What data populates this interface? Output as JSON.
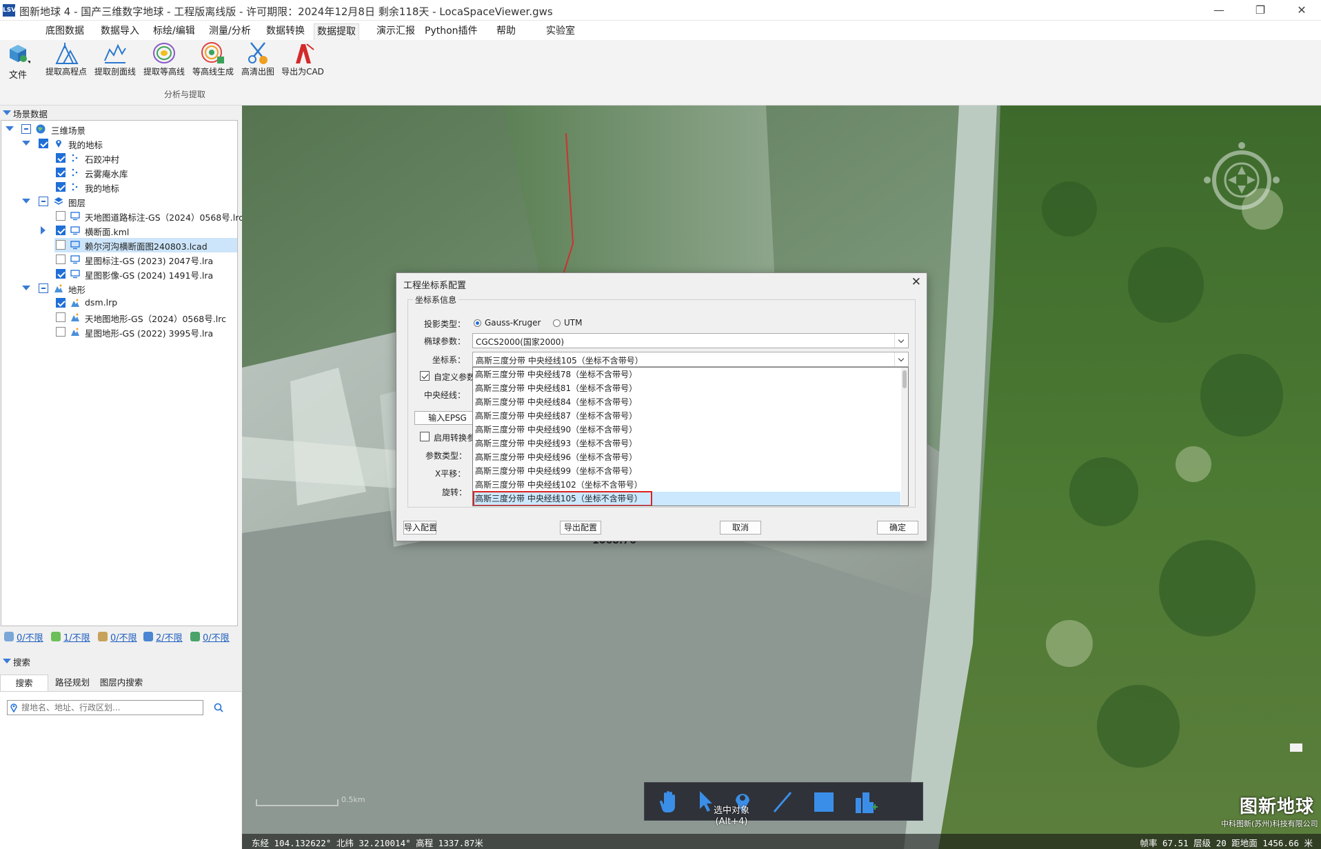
{
  "window": {
    "logo": "LSV",
    "title": "图新地球 4 - 国产三维数字地球 - 工程版离线版 - 许可期限：2024年12月8日 剩余118天 - LocaSpaceViewer.gws"
  },
  "menu": [
    "底图数据",
    "数据导入",
    "标绘/编辑",
    "测量/分析",
    "数据转换",
    "数据提取",
    "演示汇报",
    "Python插件",
    "帮助",
    "实验室"
  ],
  "ribbon": {
    "file_label": "文件",
    "tools": [
      "提取高程点",
      "提取剖面线",
      "提取等高线",
      "等高线生成",
      "高清出图",
      "导出为CAD"
    ],
    "group_label": "分析与提取"
  },
  "scene_panel": {
    "header": "场景数据",
    "tree": [
      {
        "label": "三维场景",
        "icon": "globe-icon"
      },
      {
        "label": "我的地标",
        "icon": "pin-icon"
      },
      {
        "label": "石跤冲村",
        "icon": "dots-icon"
      },
      {
        "label": "云雾庵水库",
        "icon": "dots-icon"
      },
      {
        "label": "我的地标",
        "icon": "dots-icon"
      },
      {
        "label": "图层",
        "icon": "layers-icon"
      },
      {
        "label": "天地图道路标注-GS（2024）0568号.lrc",
        "icon": "monitor-icon"
      },
      {
        "label": "横断面.kml",
        "icon": "monitor-icon"
      },
      {
        "label": "赖尔河沟横断面图240803.lcad",
        "icon": "monitor-icon"
      },
      {
        "label": "星图标注-GS (2023) 2047号.lra",
        "icon": "monitor-icon"
      },
      {
        "label": "星图影像-GS (2024) 1491号.lra",
        "icon": "monitor-icon"
      },
      {
        "label": "地形",
        "icon": "terrain-icon"
      },
      {
        "label": "dsm.lrp",
        "icon": "terrain-icon"
      },
      {
        "label": "天地图地形-GS（2024）0568号.lrc",
        "icon": "terrain-icon"
      },
      {
        "label": "星图地形-GS (2022) 3995号.lra",
        "icon": "terrain-icon"
      }
    ]
  },
  "status_links": [
    "0/不限",
    "1/不限",
    "0/不限",
    "2/不限",
    "0/不限"
  ],
  "search_panel": {
    "header": "搜索",
    "tabs": [
      "搜索",
      "路径规划",
      "图层内搜索"
    ],
    "placeholder": "搜地名、地址、行政区划..."
  },
  "map": {
    "toolbar_tooltip": "选中对象\n(Alt+4)",
    "brand_title": "图新地球",
    "brand_sub": "中科图新(苏州)科技有限公司",
    "scale_text": "0.5km",
    "coords": "东经 104.132622° 北纬 32.210014°  高程 1337.87米",
    "fps": "帧率 67.51  层级 20  距地面 1456.66 米",
    "map_label": "1068.76"
  },
  "dialog": {
    "title": "工程坐标系配置",
    "group_title": "坐标系信息",
    "projection_label": "投影类型：",
    "projection_options": [
      "Gauss-Kruger",
      "UTM"
    ],
    "ellipsoid_label": "椭球参数：",
    "ellipsoid_value": "CGCS2000(国家2000)",
    "crs_label": "坐标系：",
    "crs_value": "高斯三度分带 中央经线105（坐标不含带号）",
    "custom_param": "自定义参数",
    "central_meridian": "中央经线：",
    "epsg_button": "输入EPSG",
    "enable_transform": "启用转换参数",
    "param_type": "参数类型：",
    "x_shift": "X平移：",
    "rotate": "旋转：",
    "dropdown_items": [
      "高斯三度分带 中央经线78（坐标不含带号）",
      "高斯三度分带 中央经线81（坐标不含带号）",
      "高斯三度分带 中央经线84（坐标不含带号）",
      "高斯三度分带 中央经线87（坐标不含带号）",
      "高斯三度分带 中央经线90（坐标不含带号）",
      "高斯三度分带 中央经线93（坐标不含带号）",
      "高斯三度分带 中央经线96（坐标不含带号）",
      "高斯三度分带 中央经线99（坐标不含带号）",
      "高斯三度分带 中央经线102（坐标不含带号）",
      "高斯三度分带 中央经线105（坐标不含带号）"
    ],
    "import_button": "导入配置",
    "export_button": "导出配置",
    "cancel_button": "取消",
    "ok_button": "确定"
  }
}
